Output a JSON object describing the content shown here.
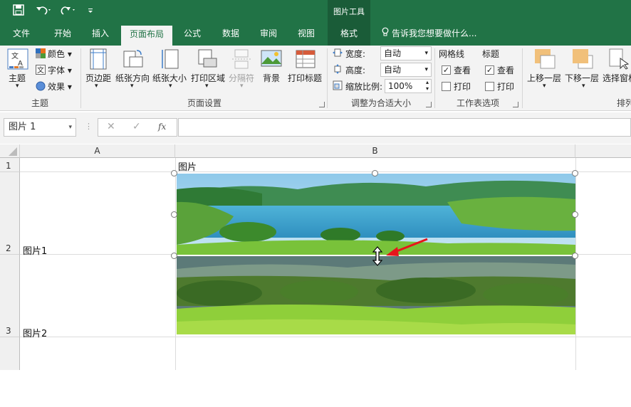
{
  "quick_access": {
    "save_icon": "save-icon",
    "undo_icon": "undo-icon",
    "redo_icon": "redo-icon",
    "customize_icon": "customize-qa-icon"
  },
  "contextual": {
    "label": "图片工具",
    "tab": "格式"
  },
  "tabs": [
    "文件",
    "开始",
    "插入",
    "页面布局",
    "公式",
    "数据",
    "审阅",
    "视图"
  ],
  "active_tab": "页面布局",
  "tell_me": "告诉我您想要做什么...",
  "ribbon": {
    "themes": {
      "theme_label": "主题",
      "colors": "颜色",
      "fonts": "字体",
      "effects": "效果",
      "group": "主题"
    },
    "page_setup": {
      "margins": "页边距",
      "orientation": "纸张方向",
      "size": "纸张大小",
      "print_area": "打印区域",
      "breaks": "分隔符",
      "background": "背景",
      "print_titles": "打印标题",
      "group": "页面设置"
    },
    "scale": {
      "width_label": "宽度:",
      "width_value": "自动",
      "height_label": "高度:",
      "height_value": "自动",
      "scale_label": "缩放比例:",
      "scale_value": "100%",
      "group": "调整为合适大小"
    },
    "sheet_options": {
      "gridlines": "网格线",
      "headings": "标题",
      "view": "查看",
      "print": "打印",
      "group": "工作表选项",
      "gridlines_view": true,
      "gridlines_print": false,
      "headings_view": true,
      "headings_print": false
    },
    "arrange": {
      "bring_forward": "上移一层",
      "send_backward": "下移一层",
      "selection_pane": "选择窗格",
      "group": "排列"
    }
  },
  "formula_bar": {
    "name_box": "图片 1",
    "cancel": "✕",
    "enter": "✓",
    "fx": "fx",
    "formula": ""
  },
  "columns": [
    "A",
    "B"
  ],
  "rows": [
    "1",
    "2",
    "3"
  ],
  "cells": {
    "B1": "图片",
    "A2": "图片1",
    "A3": "图片2"
  },
  "colors": {
    "accent": "#217346",
    "arrow": "#e8141c"
  }
}
